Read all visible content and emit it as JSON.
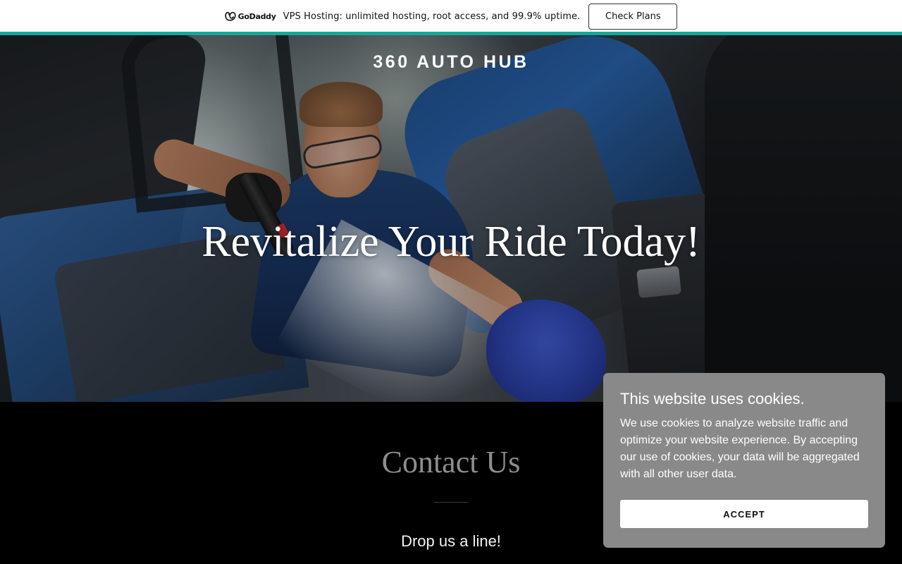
{
  "promo": {
    "brand": "GoDaddy",
    "brand_icon": "godaddy-logo-icon",
    "text": "VPS Hosting: unlimited hosting, root access, and 99.9% uptime.",
    "button_label": "Check Plans",
    "accent_color": "#13a89e"
  },
  "hero": {
    "site_title": "360 AUTO HUB",
    "headline": "Revitalize Your Ride Today!"
  },
  "contact": {
    "title": "Contact Us",
    "subtitle": "Drop us a line!"
  },
  "cookie_banner": {
    "title": "This website uses cookies.",
    "body": "We use cookies to analyze website traffic and optimize your website experience. By accepting our use of cookies, your data will be aggregated with all other user data.",
    "accept_label": "ACCEPT",
    "background_color": "#898989"
  }
}
